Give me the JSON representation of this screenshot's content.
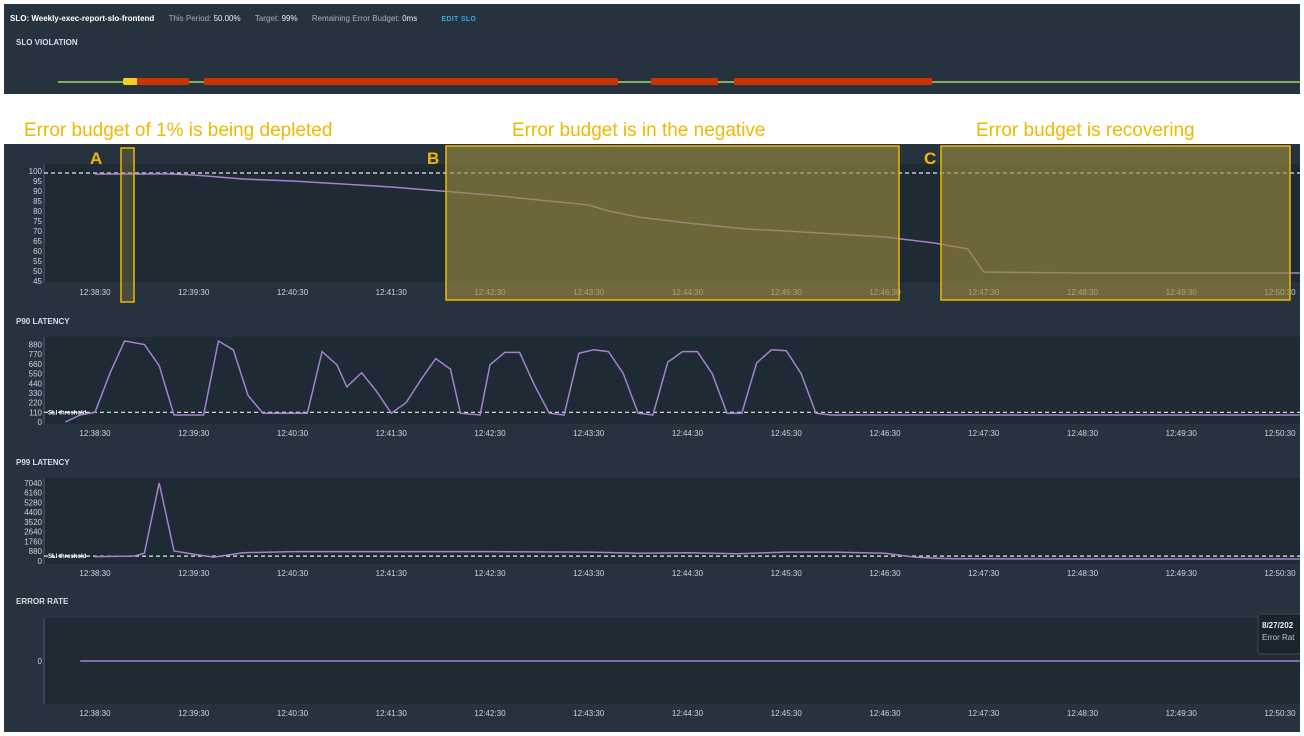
{
  "header": {
    "title": "SLO: Weekly-exec-report-slo-frontend",
    "this_period_label": "This Period:",
    "this_period_value": "50.00%",
    "target_label": "Target:",
    "target_value": "99%",
    "remaining_label": "Remaining Error Budget:",
    "remaining_value": "0ms",
    "edit_label": "EDIT SLO"
  },
  "sections": {
    "slo_violation": "SLO VIOLATION",
    "p90": "P90 LATENCY",
    "p99": "P99 LATENCY",
    "error_rate": "ERROR RATE"
  },
  "annotations": {
    "depleting": "Error budget of 1% is being depleted",
    "negative": "Error budget is in the negative",
    "recovering": "Error budget is recovering",
    "marker_a": "A",
    "marker_b": "B",
    "marker_c": "C"
  },
  "colors": {
    "background": "#26333f",
    "plot_bg": "#1e2a34",
    "series": "#a77fd0",
    "violation": "#cc3300",
    "ok_line": "#7fae5a",
    "warning": "#f5d020",
    "highlight": "#f0b800"
  },
  "tooltip": {
    "date": "8/27/202",
    "label": "Error Rat"
  },
  "chart_data": [
    {
      "id": "slo",
      "type": "line",
      "x_ticks": [
        "12:38:30",
        "12:39:30",
        "12:40:30",
        "12:41:30",
        "12:42:30",
        "12:43:30",
        "12:44:30",
        "12:45:30",
        "12:46:30",
        "12:47:30",
        "12:48:30",
        "12:49:30",
        "12:50:30"
      ],
      "y_ticks": [
        "100",
        "95",
        "90",
        "85",
        "80",
        "75",
        "70",
        "65",
        "60",
        "55",
        "50",
        "45"
      ],
      "ylim": [
        45,
        102
      ],
      "threshold": 99,
      "x": [
        0,
        0.5,
        0.7,
        1,
        1.5,
        2,
        3,
        4,
        5,
        5.2,
        5.5,
        6,
        6.6,
        7,
        8,
        8.5,
        8.84,
        9,
        10,
        11,
        12,
        12.2
      ],
      "y": [
        98.5,
        98.5,
        98.6,
        98,
        96,
        95,
        92,
        88,
        83,
        80,
        77,
        74,
        71,
        70,
        67,
        64,
        61,
        49.5,
        49,
        49,
        49,
        49
      ]
    },
    {
      "id": "p90",
      "type": "line",
      "x_ticks": [
        "12:38:30",
        "12:39:30",
        "12:40:30",
        "12:41:30",
        "12:42:30",
        "12:43:30",
        "12:44:30",
        "12:45:30",
        "12:46:30",
        "12:47:30",
        "12:48:30",
        "12:49:30",
        "12:50:30"
      ],
      "y_ticks": [
        "880",
        "770",
        "660",
        "550",
        "440",
        "330",
        "220",
        "110",
        "0"
      ],
      "ylim": [
        0,
        920
      ],
      "threshold": 110,
      "threshold_label": "SLI threshold",
      "x": [
        -0.3,
        -0.15,
        0,
        0.15,
        0.3,
        0.5,
        0.65,
        0.8,
        0.95,
        1.1,
        1.25,
        1.4,
        1.55,
        1.7,
        1.85,
        2,
        2.15,
        2.3,
        2.45,
        2.55,
        2.7,
        2.85,
        3,
        3.15,
        3.3,
        3.45,
        3.6,
        3.7,
        3.9,
        4,
        4.15,
        4.3,
        4.45,
        4.6,
        4.75,
        4.9,
        5.05,
        5.2,
        5.35,
        5.5,
        5.65,
        5.8,
        5.95,
        6.1,
        6.25,
        6.4,
        6.55,
        6.7,
        6.85,
        7,
        7.15,
        7.3,
        7.45,
        7.6,
        7.75,
        7.9,
        8.05,
        8.2,
        8.35,
        8.45,
        12.2
      ],
      "y": [
        0,
        80,
        110,
        550,
        920,
        880,
        640,
        80,
        80,
        80,
        920,
        820,
        300,
        100,
        100,
        100,
        100,
        800,
        650,
        400,
        560,
        350,
        100,
        220,
        480,
        720,
        600,
        100,
        80,
        650,
        790,
        790,
        420,
        100,
        80,
        780,
        820,
        800,
        550,
        100,
        80,
        680,
        800,
        800,
        550,
        100,
        100,
        670,
        820,
        810,
        550,
        100,
        80,
        80,
        80,
        80,
        80,
        80,
        80,
        80,
        80
      ]
    },
    {
      "id": "p99",
      "type": "line",
      "x_ticks": [
        "12:38:30",
        "12:39:30",
        "12:40:30",
        "12:41:30",
        "12:42:30",
        "12:43:30",
        "12:44:30",
        "12:45:30",
        "12:46:30",
        "12:47:30",
        "12:48:30",
        "12:49:30",
        "12:50:30"
      ],
      "y_ticks": [
        "7040",
        "6160",
        "5280",
        "4400",
        "3520",
        "2640",
        "1760",
        "880",
        "0"
      ],
      "ylim": [
        0,
        7300
      ],
      "threshold": 440,
      "threshold_label": "SLI threshold",
      "x": [
        0,
        0.4,
        0.5,
        0.65,
        0.8,
        1,
        1.2,
        1.5,
        2,
        3,
        4,
        5,
        5.5,
        6,
        6.5,
        7,
        7.5,
        8,
        8.3,
        8.5,
        8.7,
        9,
        10,
        11,
        12,
        12.2
      ],
      "y": [
        380,
        450,
        700,
        7040,
        900,
        600,
        350,
        750,
        850,
        850,
        850,
        800,
        700,
        750,
        650,
        800,
        800,
        700,
        350,
        250,
        200,
        200,
        180,
        180,
        180,
        180
      ]
    },
    {
      "id": "error_rate",
      "type": "line",
      "x_ticks": [
        "12:38:30",
        "12:39:30",
        "12:40:30",
        "12:41:30",
        "12:42:30",
        "12:43:30",
        "12:44:30",
        "12:45:30",
        "12:46:30",
        "12:47:30",
        "12:48:30",
        "12:49:30",
        "12:50:30"
      ],
      "y_ticks": [
        "0"
      ],
      "ylim": [
        -1,
        1
      ],
      "x": [
        -0.15,
        12.2
      ],
      "y": [
        0,
        0
      ]
    }
  ]
}
